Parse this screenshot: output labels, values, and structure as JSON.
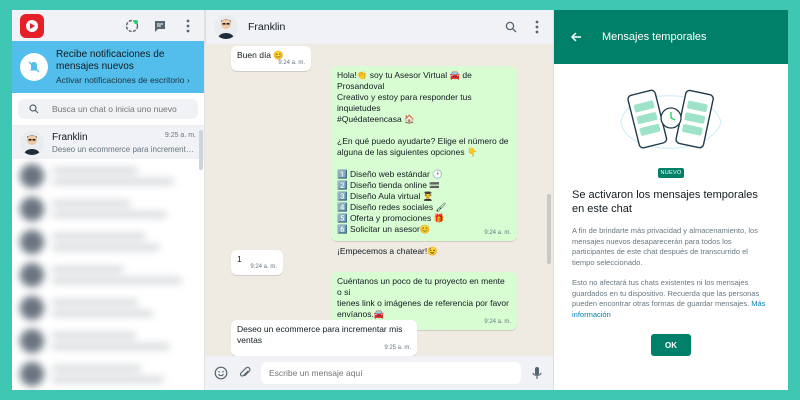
{
  "left": {
    "notification": {
      "title": "Recibe notificaciones de mensajes nuevos",
      "action": "Activar notificaciones de escritorio ›"
    },
    "search": {
      "placeholder": "Busca un chat o inicia uno nuevo"
    },
    "chats": [
      {
        "name": "Franklin",
        "time": "9:25 a. m.",
        "preview": "Deseo un ecommerce para incrementar las ventas"
      }
    ]
  },
  "center": {
    "contact_name": "Franklin",
    "messages": [
      {
        "dir": "in",
        "text": "Buen día 😊",
        "time": "9:24 a. m."
      },
      {
        "dir": "out",
        "lines": [
          "Hola!👏 soy tu Asesor Virtual 🚘 de Prosandoval",
          "Creativo y estoy para responder tus inquietudes",
          "#Quédateencasa 🏠",
          "",
          "¿En qué puedo ayudarte? Elige el número de",
          "alguna de las siguientes opciones 👇",
          "",
          "1️⃣ Diseño web estándar 🕑",
          "2️⃣ Diseño tienda online 🟰",
          "3️⃣ Diseño Aula virtual 👨‍🎓",
          "4️⃣ Diseño redes sociales 🖌",
          "5️⃣ Oferta y promociones 🎁",
          "6️⃣ Solicitar un asesor😊",
          "",
          "¡Empecemos a chatear!😉"
        ],
        "time": "9:24 a. m."
      },
      {
        "dir": "in",
        "text": "1",
        "time": "9:24 a. m."
      },
      {
        "dir": "out",
        "lines": [
          "Cuéntanos un poco de tu proyecto en mente o si",
          "tienes link o imágenes de referencia por favor",
          "envíanos.🚘"
        ],
        "time": "9:24 a. m."
      },
      {
        "dir": "in",
        "lines": [
          "Deseo un ecommerce para incrementar mis",
          "ventas"
        ],
        "time": "9:25 a. m."
      }
    ],
    "composer": {
      "placeholder": "Escribe un mensaje aquí"
    }
  },
  "right": {
    "title": "Mensajes temporales",
    "badge": "NUEVO",
    "heading": "Se activaron los mensajes temporales en este chat",
    "para1": "A fin de brindarte más privacidad y almacenamiento, los mensajes nuevos desaparecerán para todos los participantes de este chat después de transcurrido el tiempo seleccionado.",
    "para2": "Esto no afectará tus chats existentes ni los mensajes guardados en tu dispositivo. Recuerda que las personas pueden encontrar otras formas de guardar mensajes.",
    "link": "Más información",
    "ok": "OK"
  },
  "colors": {
    "brand": "#008069",
    "notification": "#53bdeb",
    "outgoing": "#d9fdd3",
    "background": "#3fc7b4"
  }
}
